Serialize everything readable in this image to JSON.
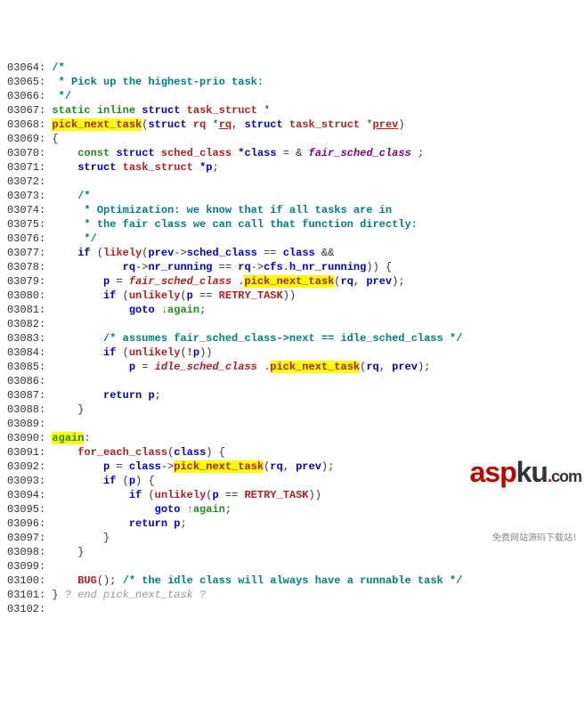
{
  "lines": [
    {
      "num": "03064:",
      "c": [
        {
          "t": " ",
          "cls": "plain"
        },
        {
          "t": "/*",
          "cls": "comment"
        }
      ]
    },
    {
      "num": "03065:",
      "c": [
        {
          "t": "  * Pick up the highest-prio task:",
          "cls": "comment"
        }
      ]
    },
    {
      "num": "03066:",
      "c": [
        {
          "t": "  */",
          "cls": "comment"
        }
      ]
    },
    {
      "num": "03067:",
      "c": [
        {
          "t": " ",
          "cls": "plain"
        },
        {
          "t": "static inline",
          "cls": "kw-green"
        },
        {
          "t": " ",
          "cls": "plain"
        },
        {
          "t": "struct",
          "cls": "kw-blue"
        },
        {
          "t": " ",
          "cls": "plain"
        },
        {
          "t": "task_struct",
          "cls": "struct-name-red"
        },
        {
          "t": " *",
          "cls": "plain"
        }
      ]
    },
    {
      "num": "03068:",
      "c": [
        {
          "t": " ",
          "cls": "plain"
        },
        {
          "t": "pick_next_task",
          "cls": "hl-red"
        },
        {
          "t": "(",
          "cls": "plain"
        },
        {
          "t": "struct",
          "cls": "kw-blue"
        },
        {
          "t": " ",
          "cls": "plain"
        },
        {
          "t": "rq",
          "cls": "struct-name-red"
        },
        {
          "t": " *",
          "cls": "plain"
        },
        {
          "t": "rq",
          "cls": "link"
        },
        {
          "t": ", ",
          "cls": "plain"
        },
        {
          "t": "struct",
          "cls": "kw-blue"
        },
        {
          "t": " ",
          "cls": "plain"
        },
        {
          "t": "task_struct",
          "cls": "struct-name-red"
        },
        {
          "t": " *",
          "cls": "plain"
        },
        {
          "t": "prev",
          "cls": "link"
        },
        {
          "t": ")",
          "cls": "plain"
        }
      ]
    },
    {
      "num": "03069:",
      "c": [
        {
          "t": " {",
          "cls": "plain"
        }
      ]
    },
    {
      "num": "03070:",
      "c": [
        {
          "t": "     ",
          "cls": "plain"
        },
        {
          "t": "const",
          "cls": "kw-green"
        },
        {
          "t": " ",
          "cls": "plain"
        },
        {
          "t": "struct",
          "cls": "kw-blue"
        },
        {
          "t": " ",
          "cls": "plain"
        },
        {
          "t": "sched_class",
          "cls": "struct-name-red"
        },
        {
          "t": " ",
          "cls": "plain"
        },
        {
          "t": "*class",
          "cls": "punct-b"
        },
        {
          "t": " = & ",
          "cls": "plain"
        },
        {
          "t": "fair_sched_class",
          "cls": "ident-purple"
        },
        {
          "t": " ;",
          "cls": "plain"
        }
      ]
    },
    {
      "num": "03071:",
      "c": [
        {
          "t": "     ",
          "cls": "plain"
        },
        {
          "t": "struct",
          "cls": "kw-blue"
        },
        {
          "t": " ",
          "cls": "plain"
        },
        {
          "t": "task_struct",
          "cls": "struct-name-red"
        },
        {
          "t": " ",
          "cls": "plain"
        },
        {
          "t": "*p",
          "cls": "punct-b"
        },
        {
          "t": ";",
          "cls": "plain"
        }
      ]
    },
    {
      "num": "03072:",
      "c": [
        {
          "t": " ",
          "cls": "plain"
        }
      ]
    },
    {
      "num": "03073:",
      "c": [
        {
          "t": "     ",
          "cls": "plain"
        },
        {
          "t": "/*",
          "cls": "comment"
        }
      ]
    },
    {
      "num": "03074:",
      "c": [
        {
          "t": "      * Optimization: we know that if all tasks are in",
          "cls": "comment"
        }
      ]
    },
    {
      "num": "03075:",
      "c": [
        {
          "t": "      * the fair class we can call that function directly:",
          "cls": "comment"
        }
      ]
    },
    {
      "num": "03076:",
      "c": [
        {
          "t": "      */",
          "cls": "comment"
        }
      ]
    },
    {
      "num": "03077:",
      "c": [
        {
          "t": "     ",
          "cls": "plain"
        },
        {
          "t": "if",
          "cls": "kw-blue"
        },
        {
          "t": " (",
          "cls": "plain"
        },
        {
          "t": "likely",
          "cls": "func-red"
        },
        {
          "t": "(",
          "cls": "plain"
        },
        {
          "t": "prev",
          "cls": "punct-b"
        },
        {
          "t": "->",
          "cls": "plain"
        },
        {
          "t": "sched_class",
          "cls": "punct-b"
        },
        {
          "t": " == ",
          "cls": "plain"
        },
        {
          "t": "class",
          "cls": "punct-b"
        },
        {
          "t": " &&",
          "cls": "plain"
        }
      ]
    },
    {
      "num": "03078:",
      "c": [
        {
          "t": "            ",
          "cls": "plain"
        },
        {
          "t": "rq",
          "cls": "punct-b"
        },
        {
          "t": "->",
          "cls": "plain"
        },
        {
          "t": "nr_running",
          "cls": "punct-b"
        },
        {
          "t": " == ",
          "cls": "plain"
        },
        {
          "t": "rq",
          "cls": "punct-b"
        },
        {
          "t": "->",
          "cls": "plain"
        },
        {
          "t": "cfs",
          "cls": "punct-b"
        },
        {
          "t": ".",
          "cls": "plain"
        },
        {
          "t": "h_nr_running",
          "cls": "punct-b"
        },
        {
          "t": ")) {",
          "cls": "plain"
        }
      ]
    },
    {
      "num": "03079:",
      "c": [
        {
          "t": "         ",
          "cls": "plain"
        },
        {
          "t": "p",
          "cls": "punct-b"
        },
        {
          "t": " = ",
          "cls": "plain"
        },
        {
          "t": "fair_sched_class",
          "cls": "ident-red-ital"
        },
        {
          "t": " .",
          "cls": "plain"
        },
        {
          "t": "pick_next_task",
          "cls": "hl-red"
        },
        {
          "t": "(",
          "cls": "plain"
        },
        {
          "t": "rq",
          "cls": "punct-b"
        },
        {
          "t": ", ",
          "cls": "plain"
        },
        {
          "t": "prev",
          "cls": "punct-b"
        },
        {
          "t": ");",
          "cls": "plain"
        }
      ]
    },
    {
      "num": "03080:",
      "c": [
        {
          "t": "         ",
          "cls": "plain"
        },
        {
          "t": "if",
          "cls": "kw-blue"
        },
        {
          "t": " (",
          "cls": "plain"
        },
        {
          "t": "unlikely",
          "cls": "func-red"
        },
        {
          "t": "(",
          "cls": "plain"
        },
        {
          "t": "p",
          "cls": "punct-b"
        },
        {
          "t": " == ",
          "cls": "plain"
        },
        {
          "t": "RETRY_TASK",
          "cls": "const-red"
        },
        {
          "t": "))",
          "cls": "plain"
        }
      ]
    },
    {
      "num": "03081:",
      "c": [
        {
          "t": "             ",
          "cls": "plain"
        },
        {
          "t": "goto",
          "cls": "kw-blue"
        },
        {
          "t": " ",
          "cls": "plain"
        },
        {
          "t": "↓again",
          "cls": "label-green"
        },
        {
          "t": ";",
          "cls": "plain"
        }
      ]
    },
    {
      "num": "03082:",
      "c": [
        {
          "t": " ",
          "cls": "plain"
        }
      ]
    },
    {
      "num": "03083:",
      "c": [
        {
          "t": "         ",
          "cls": "plain"
        },
        {
          "t": "/* assumes fair_sched_class->next == idle_sched_class */",
          "cls": "comment"
        }
      ]
    },
    {
      "num": "03084:",
      "c": [
        {
          "t": "         ",
          "cls": "plain"
        },
        {
          "t": "if",
          "cls": "kw-blue"
        },
        {
          "t": " (",
          "cls": "plain"
        },
        {
          "t": "unlikely",
          "cls": "func-red"
        },
        {
          "t": "(",
          "cls": "plain"
        },
        {
          "t": "!",
          "cls": "not"
        },
        {
          "t": "p",
          "cls": "punct-b"
        },
        {
          "t": "))",
          "cls": "plain"
        }
      ]
    },
    {
      "num": "03085:",
      "c": [
        {
          "t": "             ",
          "cls": "plain"
        },
        {
          "t": "p",
          "cls": "punct-b"
        },
        {
          "t": " = ",
          "cls": "plain"
        },
        {
          "t": "idle_sched_class",
          "cls": "ident-red-ital"
        },
        {
          "t": " .",
          "cls": "plain"
        },
        {
          "t": "pick_next_task",
          "cls": "hl-red"
        },
        {
          "t": "(",
          "cls": "plain"
        },
        {
          "t": "rq",
          "cls": "punct-b"
        },
        {
          "t": ", ",
          "cls": "plain"
        },
        {
          "t": "prev",
          "cls": "punct-b"
        },
        {
          "t": ");",
          "cls": "plain"
        }
      ]
    },
    {
      "num": "03086:",
      "c": [
        {
          "t": " ",
          "cls": "plain"
        }
      ]
    },
    {
      "num": "03087:",
      "c": [
        {
          "t": "         ",
          "cls": "plain"
        },
        {
          "t": "return",
          "cls": "kw-blue"
        },
        {
          "t": " ",
          "cls": "plain"
        },
        {
          "t": "p",
          "cls": "punct-b"
        },
        {
          "t": ";",
          "cls": "plain"
        }
      ]
    },
    {
      "num": "03088:",
      "c": [
        {
          "t": "     }",
          "cls": "plain"
        }
      ]
    },
    {
      "num": "03089:",
      "c": [
        {
          "t": " ",
          "cls": "plain"
        }
      ]
    },
    {
      "num": "03090:",
      "c": [
        {
          "t": " ",
          "cls": "plain"
        },
        {
          "t": "again",
          "cls": "label-green-hl"
        },
        {
          "t": ":",
          "cls": "plain"
        }
      ]
    },
    {
      "num": "03091:",
      "c": [
        {
          "t": "     ",
          "cls": "plain"
        },
        {
          "t": "for_each_class",
          "cls": "func-red"
        },
        {
          "t": "(",
          "cls": "plain"
        },
        {
          "t": "class",
          "cls": "punct-b"
        },
        {
          "t": ") {",
          "cls": "plain"
        }
      ]
    },
    {
      "num": "03092:",
      "c": [
        {
          "t": "         ",
          "cls": "plain"
        },
        {
          "t": "p",
          "cls": "punct-b"
        },
        {
          "t": " = ",
          "cls": "plain"
        },
        {
          "t": "class",
          "cls": "punct-b"
        },
        {
          "t": "->",
          "cls": "plain"
        },
        {
          "t": "pick_next_task",
          "cls": "hl-red"
        },
        {
          "t": "(",
          "cls": "plain"
        },
        {
          "t": "rq",
          "cls": "punct-b"
        },
        {
          "t": ", ",
          "cls": "plain"
        },
        {
          "t": "prev",
          "cls": "punct-b"
        },
        {
          "t": ");",
          "cls": "plain"
        }
      ]
    },
    {
      "num": "03093:",
      "c": [
        {
          "t": "         ",
          "cls": "plain"
        },
        {
          "t": "if",
          "cls": "kw-blue"
        },
        {
          "t": " (",
          "cls": "plain"
        },
        {
          "t": "p",
          "cls": "punct-b"
        },
        {
          "t": ") {",
          "cls": "plain"
        }
      ]
    },
    {
      "num": "03094:",
      "c": [
        {
          "t": "             ",
          "cls": "plain"
        },
        {
          "t": "if",
          "cls": "kw-blue"
        },
        {
          "t": " (",
          "cls": "plain"
        },
        {
          "t": "unlikely",
          "cls": "func-red"
        },
        {
          "t": "(",
          "cls": "plain"
        },
        {
          "t": "p",
          "cls": "punct-b"
        },
        {
          "t": " == ",
          "cls": "plain"
        },
        {
          "t": "RETRY_TASK",
          "cls": "const-red"
        },
        {
          "t": "))",
          "cls": "plain"
        }
      ]
    },
    {
      "num": "03095:",
      "c": [
        {
          "t": "                 ",
          "cls": "plain"
        },
        {
          "t": "goto",
          "cls": "kw-blue"
        },
        {
          "t": " ",
          "cls": "plain"
        },
        {
          "t": "↑again",
          "cls": "label-green"
        },
        {
          "t": ";",
          "cls": "plain"
        }
      ]
    },
    {
      "num": "03096:",
      "c": [
        {
          "t": "             ",
          "cls": "plain"
        },
        {
          "t": "return",
          "cls": "kw-blue"
        },
        {
          "t": " ",
          "cls": "plain"
        },
        {
          "t": "p",
          "cls": "punct-b"
        },
        {
          "t": ";",
          "cls": "plain"
        }
      ]
    },
    {
      "num": "03097:",
      "c": [
        {
          "t": "         }",
          "cls": "plain"
        }
      ]
    },
    {
      "num": "03098:",
      "c": [
        {
          "t": "     }",
          "cls": "plain"
        }
      ]
    },
    {
      "num": "03099:",
      "c": [
        {
          "t": " ",
          "cls": "plain"
        }
      ]
    },
    {
      "num": "03100:",
      "c": [
        {
          "t": "     ",
          "cls": "plain"
        },
        {
          "t": "BUG",
          "cls": "func-red"
        },
        {
          "t": "(); ",
          "cls": "plain"
        },
        {
          "t": "/* the idle class will always have a runnable task */",
          "cls": "comment"
        }
      ]
    },
    {
      "num": "03101:",
      "c": [
        {
          "t": " } ",
          "cls": "plain"
        },
        {
          "t": "? end pick_next_task ?",
          "cls": "gray-ital"
        }
      ]
    },
    {
      "num": "03102:",
      "c": [
        {
          "t": " ",
          "cls": "plain"
        }
      ]
    }
  ],
  "watermark": {
    "asp": "asp",
    "ku": "ku",
    ".com": ".com",
    "sub": "免费网站源码下载站！"
  }
}
